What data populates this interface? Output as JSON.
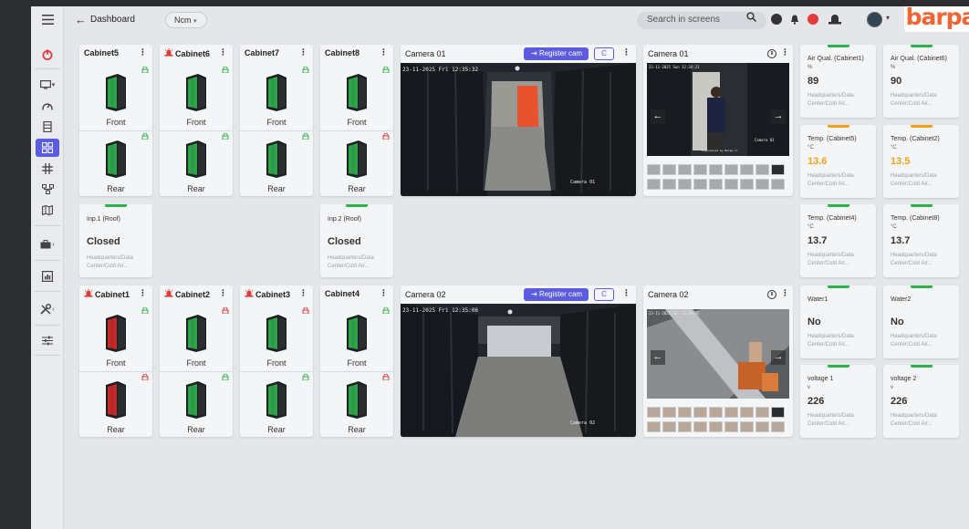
{
  "topbar": {
    "title": "Dashboard",
    "chip": "Ncm",
    "search_placeholder": "Search in screens",
    "logo": "barpa"
  },
  "sidebar": {
    "items": [
      "power-icon",
      "monitor-icon",
      "gauge-icon",
      "server-icon",
      "grid-icon",
      "hash-icon",
      "network-icon",
      "map-icon",
      "briefcase-icon",
      "chart-icon",
      "tools-icon",
      "sliders-icon"
    ]
  },
  "colors": {
    "accent": "#5b5ce0",
    "ok": "#2fb24a",
    "alarm": "#e23b3b",
    "warn": "#f2a11b",
    "logo": "#f26432",
    "rack_ok": "#2fa34a",
    "rack_alarm": "#c22a2a"
  },
  "cabinets": [
    {
      "name": "Cabinet5",
      "alarm": false,
      "front_label": "Front",
      "rear_label": "Rear",
      "front_lock": "green",
      "rear_lock": "green",
      "front_state": "ok",
      "rear_state": "ok"
    },
    {
      "name": "Cabinet6",
      "alarm": true,
      "front_label": "Front",
      "rear_label": "Rear",
      "front_lock": "green",
      "rear_lock": "green",
      "front_state": "ok",
      "rear_state": "ok"
    },
    {
      "name": "Cabinet7",
      "alarm": false,
      "front_label": "Front",
      "rear_label": "Rear",
      "front_lock": "green",
      "rear_lock": "green",
      "front_state": "ok",
      "rear_state": "ok"
    },
    {
      "name": "Cabinet8",
      "alarm": false,
      "front_label": "Front",
      "rear_label": "Rear",
      "front_lock": "green",
      "rear_lock": "red",
      "front_state": "ok",
      "rear_state": "ok"
    },
    {
      "name": "Cabinet1",
      "alarm": true,
      "front_label": "Front",
      "rear_label": "Rear",
      "front_lock": "green",
      "rear_lock": "red",
      "front_state": "alarm",
      "rear_state": "alarm"
    },
    {
      "name": "Cabinet2",
      "alarm": true,
      "front_label": "Front",
      "rear_label": "Rear",
      "front_lock": "red",
      "rear_lock": "green",
      "front_state": "ok",
      "rear_state": "ok"
    },
    {
      "name": "Cabinet3",
      "alarm": true,
      "front_label": "Front",
      "rear_label": "Rear",
      "front_lock": "red",
      "rear_lock": "green",
      "front_state": "ok",
      "rear_state": "ok"
    },
    {
      "name": "Cabinet4",
      "alarm": false,
      "front_label": "Front",
      "rear_label": "Rear",
      "front_lock": "green",
      "rear_lock": "red",
      "front_state": "ok",
      "rear_state": "ok"
    }
  ],
  "inputs": [
    {
      "title": "Inp.1 (Roof)",
      "value": "Closed",
      "location": "Headquarters/Data Center/Cold Air..."
    },
    {
      "title": "Inp.2 (Roof)",
      "value": "Closed",
      "location": "Headquarters/Data Center/Cold Air..."
    }
  ],
  "cameras": [
    {
      "title": "Camera 01",
      "register_label": "Register cam",
      "refresh_label": "C",
      "timestamp": "23-11-2025 Fri 12:35:32",
      "overlay": "Camera 01"
    },
    {
      "title": "Camera 02",
      "register_label": "Register cam",
      "refresh_label": "C",
      "timestamp": "23-11-2025 Fri 12:35:06",
      "overlay": "Camera 02"
    }
  ],
  "playback": [
    {
      "title": "Camera 01",
      "pause_label": "II",
      "timestamp": "23-11-2025 Sun 12:34:21",
      "overlay": "Camera 01",
      "caption": "Engineered by Barpa.ir"
    },
    {
      "title": "Camera 02",
      "pause_label": "II",
      "timestamp": "23-11-2025 Sun 16:34:35",
      "overlay": "",
      "caption": ""
    }
  ],
  "sensors": [
    {
      "title": "Air Qual. (Cabinet1)",
      "unit": "%",
      "value": "89",
      "color": "ok",
      "location": "Headquarters/Data Center/Cold Air..."
    },
    {
      "title": "Air Qual. (Cabinet6)",
      "unit": "%",
      "value": "90",
      "color": "ok",
      "location": "Headquarters/Data Center/Cold Air..."
    },
    {
      "title": "Temp. (Cabinet5)",
      "unit": "°C",
      "value": "13.6",
      "color": "warn",
      "location": "Headquarters/Data Center/Cold Air..."
    },
    {
      "title": "Temp. (Cabinet2)",
      "unit": "°C",
      "value": "13.5",
      "color": "warn",
      "location": "Headquarters/Data Center/Cold Air..."
    },
    {
      "title": "Temp. (Cabinet4)",
      "unit": "°C",
      "value": "13.7",
      "color": "ok",
      "location": "Headquarters/Data Center/Cold Air..."
    },
    {
      "title": "Temp. (Cabinet8)",
      "unit": "°C",
      "value": "13.7",
      "color": "ok",
      "location": "Headquarters/Data Center/Cold Air..."
    },
    {
      "title": "Water1",
      "unit": "",
      "value": "No",
      "color": "ok",
      "location": "Headquarters/Data Center/Cold Air..."
    },
    {
      "title": "Water2",
      "unit": "",
      "value": "No",
      "color": "ok",
      "location": "Headquarters/Data Center/Cold Air..."
    },
    {
      "title": "voltage 1",
      "unit": "v",
      "value": "226",
      "color": "ok",
      "location": "Headquarters/Data Center/Cold Air..."
    },
    {
      "title": "voltage 2",
      "unit": "v",
      "value": "226",
      "color": "ok",
      "location": "Headquarters/Data Center/Cold Air..."
    }
  ]
}
